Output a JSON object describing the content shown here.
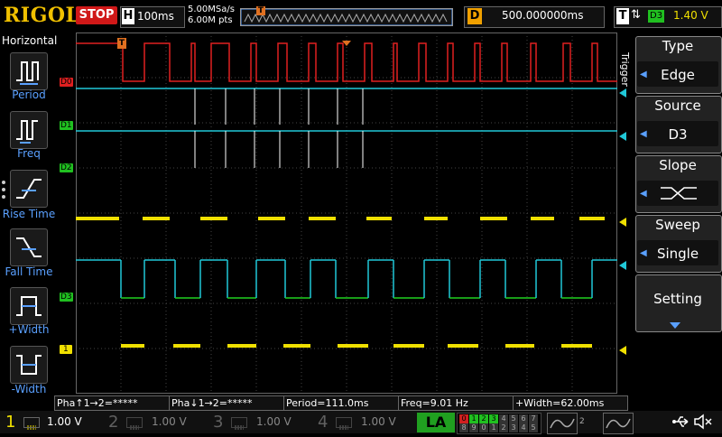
{
  "header": {
    "brand": "RIGOL",
    "run_state": "STOP",
    "timebase_label": "H",
    "timebase_value": "100ms",
    "sample_rate": "5.00MSa/s",
    "memory_depth": "6.00M pts",
    "delay_label": "D",
    "delay_value": "500.000000ms",
    "trigger_label": "T",
    "trigger_edge_icon": "rise-fall-edge-icon",
    "trigger_source": "D3",
    "trigger_level": "1.40 V"
  },
  "left_panel": {
    "title": "Horizontal",
    "items": [
      {
        "label": "Period",
        "icon": "period-icon"
      },
      {
        "label": "Freq",
        "icon": "freq-icon"
      },
      {
        "label": "Rise Time",
        "icon": "rise-time-icon"
      },
      {
        "label": "Fall Time",
        "icon": "fall-time-icon"
      },
      {
        "label": "+Width",
        "icon": "positive-width-icon"
      },
      {
        "label": "-Width",
        "icon": "negative-width-icon"
      }
    ]
  },
  "channel_labels": {
    "d0": "D0",
    "d1": "D1",
    "d2": "D2",
    "d3": "D3",
    "ch1": "1"
  },
  "trigger_menu": {
    "vertical_label": "Trigger",
    "type_title": "Type",
    "type_value": "Edge",
    "source_title": "Source",
    "source_value": "D3",
    "slope_title": "Slope",
    "sweep_title": "Sweep",
    "sweep_value": "Single",
    "setting_title": "Setting"
  },
  "measurements": [
    "Pha↑1→2=*****",
    "Pha↓1→2=*****",
    "Period=111.0ms",
    "Freq=9.01 Hz",
    "+Width=62.00ms"
  ],
  "channels": [
    {
      "num": "1",
      "scale": "1.00 V",
      "color": "#f0e000",
      "active": true
    },
    {
      "num": "2",
      "scale": "1.00 V",
      "color": "#606060",
      "active": false
    },
    {
      "num": "3",
      "scale": "1.00 V",
      "color": "#606060",
      "active": false
    },
    {
      "num": "4",
      "scale": "1.00 V",
      "color": "#606060",
      "active": false
    }
  ],
  "la": {
    "label": "LA",
    "row1": [
      "0",
      "1",
      "2",
      "3",
      "4",
      "5",
      "6",
      "7"
    ],
    "row2": [
      "8",
      "9",
      "0",
      "1",
      "2",
      "3",
      "4",
      "5"
    ]
  },
  "colors": {
    "d0": "#e02020",
    "d1_d2": "#20c8d8",
    "d3_high": "#20c8d8",
    "d3_low": "#20d020",
    "ch1": "#f0e000",
    "accent": "#5aa0ff"
  }
}
